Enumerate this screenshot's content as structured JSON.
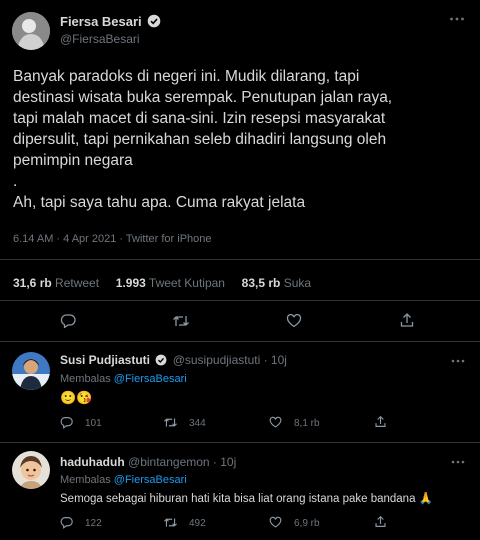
{
  "main_tweet": {
    "author_name": "Fiersa Besari",
    "author_handle": "@FiersaBesari",
    "text_lines": [
      "Banyak paradoks di negeri ini. Mudik dilarang, tapi",
      "destinasi wisata buka serempak. Penutupan jalan raya,",
      "tapi malah macet di sana-sini. Izin resepsi masyarakat",
      "dipersulit, tapi pernikahan seleb dihadiri langsung oleh",
      "pemimpin negara",
      ".",
      "Ah, tapi saya tahu apa. Cuma rakyat jelata"
    ],
    "meta": "6.14 AM · 4 Apr 2021 · Twitter for iPhone",
    "retweets_count": "31,6 rb",
    "retweets_label": "Retweet",
    "quotes_count": "1.993",
    "quotes_label": "Tweet Kutipan",
    "likes_count": "83,5 rb",
    "likes_label": "Suka"
  },
  "replies": [
    {
      "name": "Susi Pudjiastuti",
      "handle": "@susipudjiastuti · 10j",
      "replying_prefix": "Membalas ",
      "replying_to": "@FiersaBesari",
      "text": "🙂😘",
      "replies": "101",
      "retweets": "344",
      "likes": "8,1 rb"
    },
    {
      "name": "haduhaduh",
      "handle": "@bintangemon · 10j",
      "replying_prefix": "Membalas ",
      "replying_to": "@FiersaBesari",
      "text": "Semoga sebagai hiburan hati kita bisa liat orang istana pake bandana 🙏",
      "replies": "122",
      "retweets": "492",
      "likes": "6,9 rb"
    }
  ],
  "icons": {
    "verified": "verified-badge-icon",
    "more": "more-options-icon",
    "reply": "reply-icon",
    "retweet": "retweet-icon",
    "like": "like-icon",
    "share": "share-icon"
  },
  "colors": {
    "background": "#000000",
    "text": "#d9d9d9",
    "muted": "#6e767d",
    "accent": "#1d9bf0",
    "divider": "#2f3336"
  }
}
